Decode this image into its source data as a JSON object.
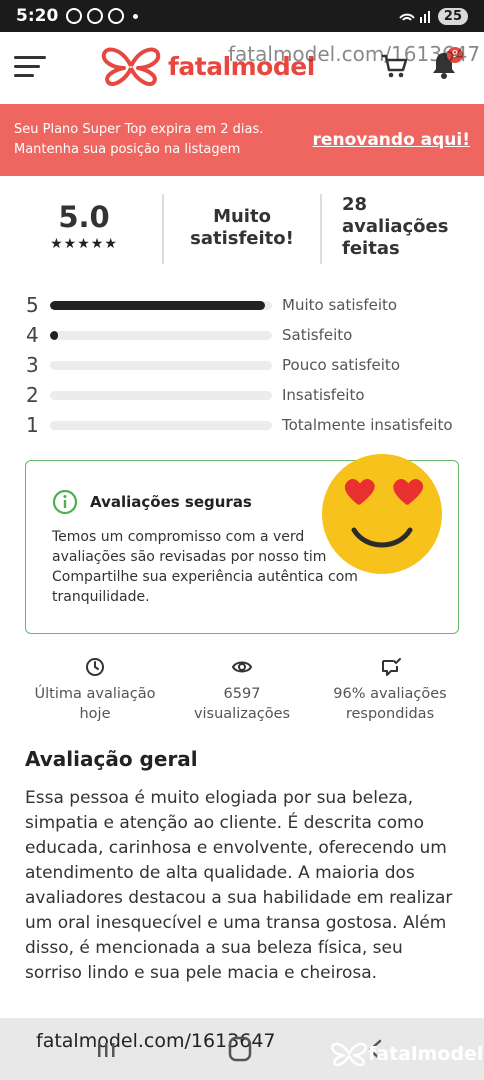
{
  "status_bar": {
    "time": "5:20",
    "battery": "25"
  },
  "header": {
    "logo_text": "fatalmodel",
    "notification_count": "9",
    "watermark": "fatalmodel.com/1613647"
  },
  "banner": {
    "line1": "Seu Plano Super Top expira em 2 dias.",
    "line2": "Mantenha sua posição na listagem",
    "link_label": "renovando aqui!"
  },
  "summary": {
    "score": "5.0",
    "stars": "★★★★★",
    "satisfaction_line1": "Muito",
    "satisfaction_line2": "satisfeito!",
    "reviews_line1": "28",
    "reviews_line2": "avaliações",
    "reviews_line3": "feitas"
  },
  "ratings": [
    {
      "stars": "5",
      "label": "Muito satisfeito",
      "fraction": 0.97
    },
    {
      "stars": "4",
      "label": "Satisfeito",
      "fraction": 0.035
    },
    {
      "stars": "3",
      "label": "Pouco satisfeito",
      "fraction": 0
    },
    {
      "stars": "2",
      "label": "Insatisfeito",
      "fraction": 0
    },
    {
      "stars": "1",
      "label": "Totalmente insatisfeito",
      "fraction": 0
    }
  ],
  "secure": {
    "title": "Avaliações seguras",
    "body_line1": "Temos um compromisso com a verd",
    "body_line2": "avaliações são revisadas por nosso tim",
    "body_line3": "Compartilhe sua experiência autêntica com",
    "body_line4": "tranquilidade."
  },
  "stats": [
    {
      "icon": "clock-icon",
      "line1": "Última avaliação",
      "line2": "hoje"
    },
    {
      "icon": "eye-icon",
      "line1": "6597",
      "line2": "visualizações"
    },
    {
      "icon": "chat-check-icon",
      "line1": "96% avaliações",
      "line2": "respondidas"
    }
  ],
  "overall": {
    "title": "Avaliação geral",
    "text": "Essa pessoa é muito elogiada por sua beleza, simpatia e atenção ao cliente. É descrita como educada, carinhosa e envolvente, oferecendo um atendimento de alta qualidade. A maioria dos avaliadores destacou a sua habilidade em realizar um oral inesquecível e uma transa gostosa. Além disso, é mencionada a sua beleza física, seu sorriso lindo e sua pele macia e cheirosa."
  },
  "bottom": {
    "watermark": "fatalmodel.com/1613647",
    "logo_text": "fatalmodel"
  },
  "colors": {
    "brand": "#e8473f",
    "banner": "#ef6661",
    "secure_border": "#67b86a"
  }
}
